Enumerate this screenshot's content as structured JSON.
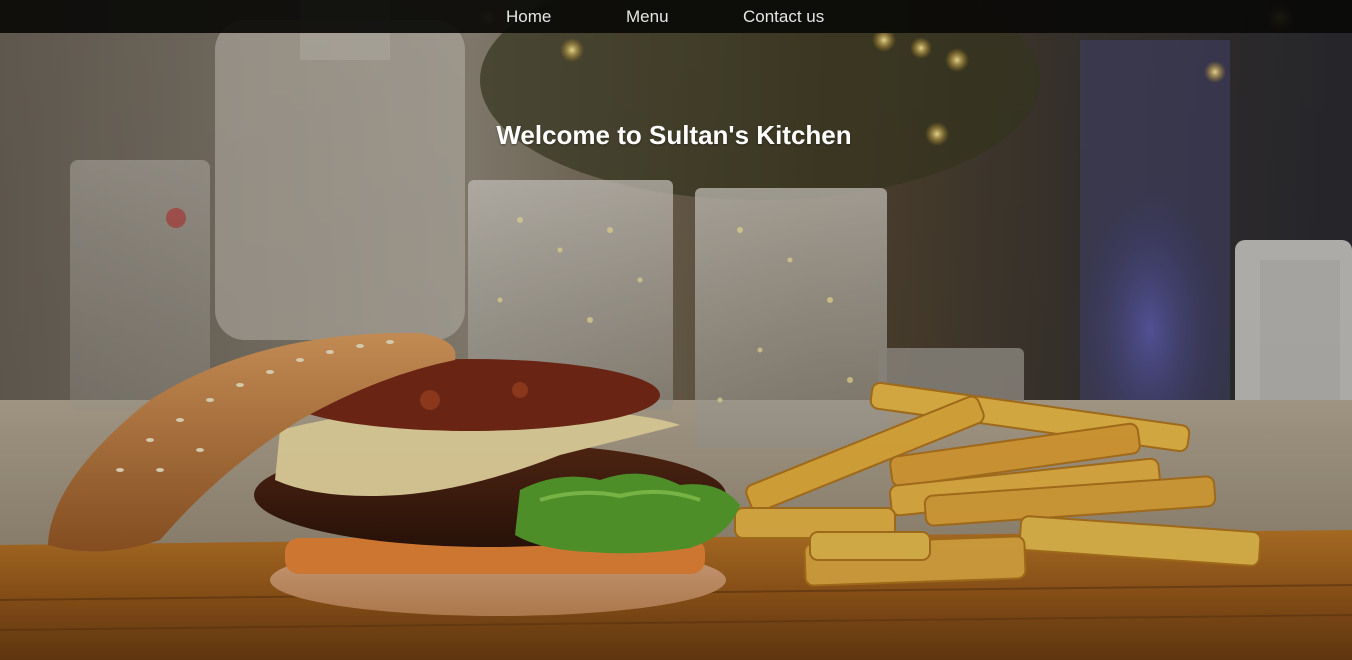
{
  "nav": {
    "items": [
      {
        "label": "Home"
      },
      {
        "label": "Menu"
      },
      {
        "label": "Contact us"
      }
    ]
  },
  "hero": {
    "heading": "Welcome to Sultan's Kitchen"
  },
  "colors": {
    "navbar_bg": "#0a0a08",
    "nav_text": "#e6e6e6",
    "heading_text": "#ffffff"
  }
}
